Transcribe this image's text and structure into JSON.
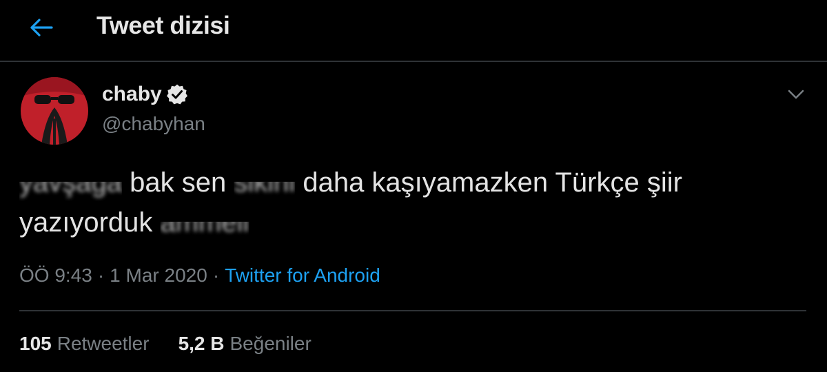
{
  "header": {
    "title": "Tweet dizisi",
    "back_icon": "arrow-left-icon"
  },
  "colors": {
    "accent": "#1da1f2",
    "background": "#000000",
    "muted": "#7a8085",
    "divider": "#2f3336"
  },
  "tweet": {
    "author": {
      "name": "chaby",
      "handle": "@chabyhan",
      "verified": true
    },
    "text": {
      "censored_1": "yavşağa",
      "part_1": " bak sen ",
      "censored_2": "sikini",
      "part_2": " daha kaşıyamazken Türkçe şiir yazıyorduk ",
      "censored_3": "ammeli"
    },
    "time": "ÖÖ 9:43",
    "date": "1 Mar 2020",
    "source": "Twitter for Android",
    "separator": "·"
  },
  "stats": {
    "retweets": {
      "count": "105",
      "label": "Retweetler"
    },
    "likes": {
      "count": "5,2 B",
      "label": "Beğeniler"
    }
  }
}
